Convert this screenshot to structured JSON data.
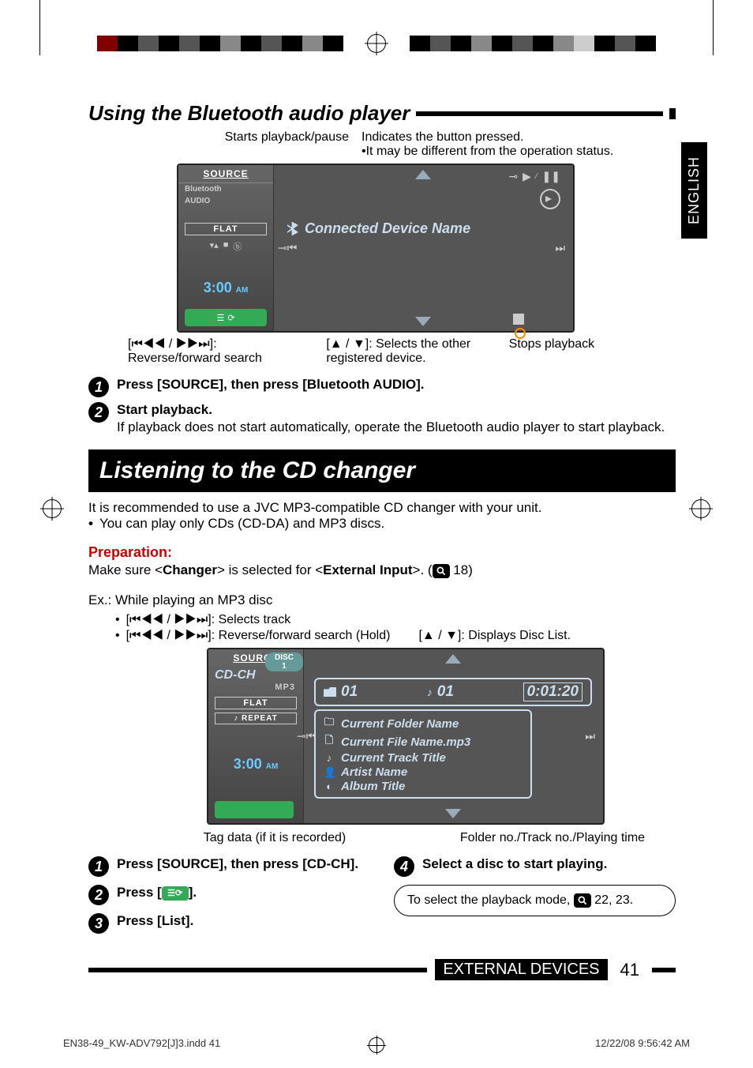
{
  "lang_tab": "ENGLISH",
  "section1": {
    "title": "Using the Bluetooth audio player",
    "callouts": {
      "starts": "Starts playback/pause",
      "indicates": "Indicates the button pressed.",
      "indicates_sub": "It may be different from the operation status.",
      "rev_fwd": "[⏮◀◀ / ▶▶⏭]: Reverse/forward search",
      "selects": "[▲ / ▼]: Selects the other registered device.",
      "stops": "Stops playback"
    },
    "screen": {
      "source_label": "SOURCE",
      "bt_line1": "Bluetooth",
      "bt_line2": "AUDIO",
      "flat": "FLAT",
      "time": "3:00",
      "am": "AM",
      "device_name": "Connected Device Name"
    },
    "steps": {
      "s1": "Press [SOURCE], then press [Bluetooth AUDIO].",
      "s2": "Start playback.",
      "s2_sub": "If playback does not start automatically, operate the Bluetooth audio player to start playback."
    }
  },
  "section2": {
    "band_title": "Listening to the CD changer",
    "intro": "It is recommended to use a JVC MP3-compatible CD changer with your unit.",
    "intro_bullet": "You can play only CDs (CD-DA) and MP3 discs.",
    "prep_head": "Preparation:",
    "prep_pre": "Make sure <",
    "prep_changer": "Changer",
    "prep_mid": "> is selected for <",
    "prep_ext": "External Input",
    "prep_post": ">. (",
    "prep_page": " 18)",
    "ex_line": "Ex.:  While playing an MP3 disc",
    "bullets": {
      "b1": "[⏮◀◀ / ▶▶⏭]: Selects track",
      "b2a": "[⏮◀◀ / ▶▶⏭]: Reverse/forward search (Hold)",
      "b2b": "[▲ / ▼]: Displays Disc List."
    },
    "screen": {
      "source_label": "SOURCE",
      "disc_badge": "DISC 1",
      "cdch": "CD-CH",
      "mp3": "MP3",
      "flat": "FLAT",
      "repeat": "♪  REPEAT",
      "time": "3:00",
      "am": "AM",
      "folder_no": "01",
      "track_no": "01",
      "play_time": "0:01:20",
      "meta": {
        "folder": "Current Folder Name",
        "file": "Current File Name.mp3",
        "track": "Current Track Title",
        "artist": "Artist Name",
        "album": "Album Title"
      }
    },
    "below": {
      "left": "Tag data (if it is recorded)",
      "right": "Folder no./Track no./Playing time"
    },
    "steps": {
      "s1": "Press [SOURCE], then press [CD-CH].",
      "s2_pre": "Press [",
      "s2_post": "].",
      "s3": "Press [List].",
      "s4": "Select a disc to start playing.",
      "tip_pre": "To select the playback mode, ",
      "tip_post": " 22, 23."
    }
  },
  "footer": {
    "label": "EXTERNAL DEVICES",
    "page": "41",
    "file": "EN38-49_KW-ADV792[J]3.indd   41",
    "date": "12/22/08   9:56:42 AM"
  }
}
